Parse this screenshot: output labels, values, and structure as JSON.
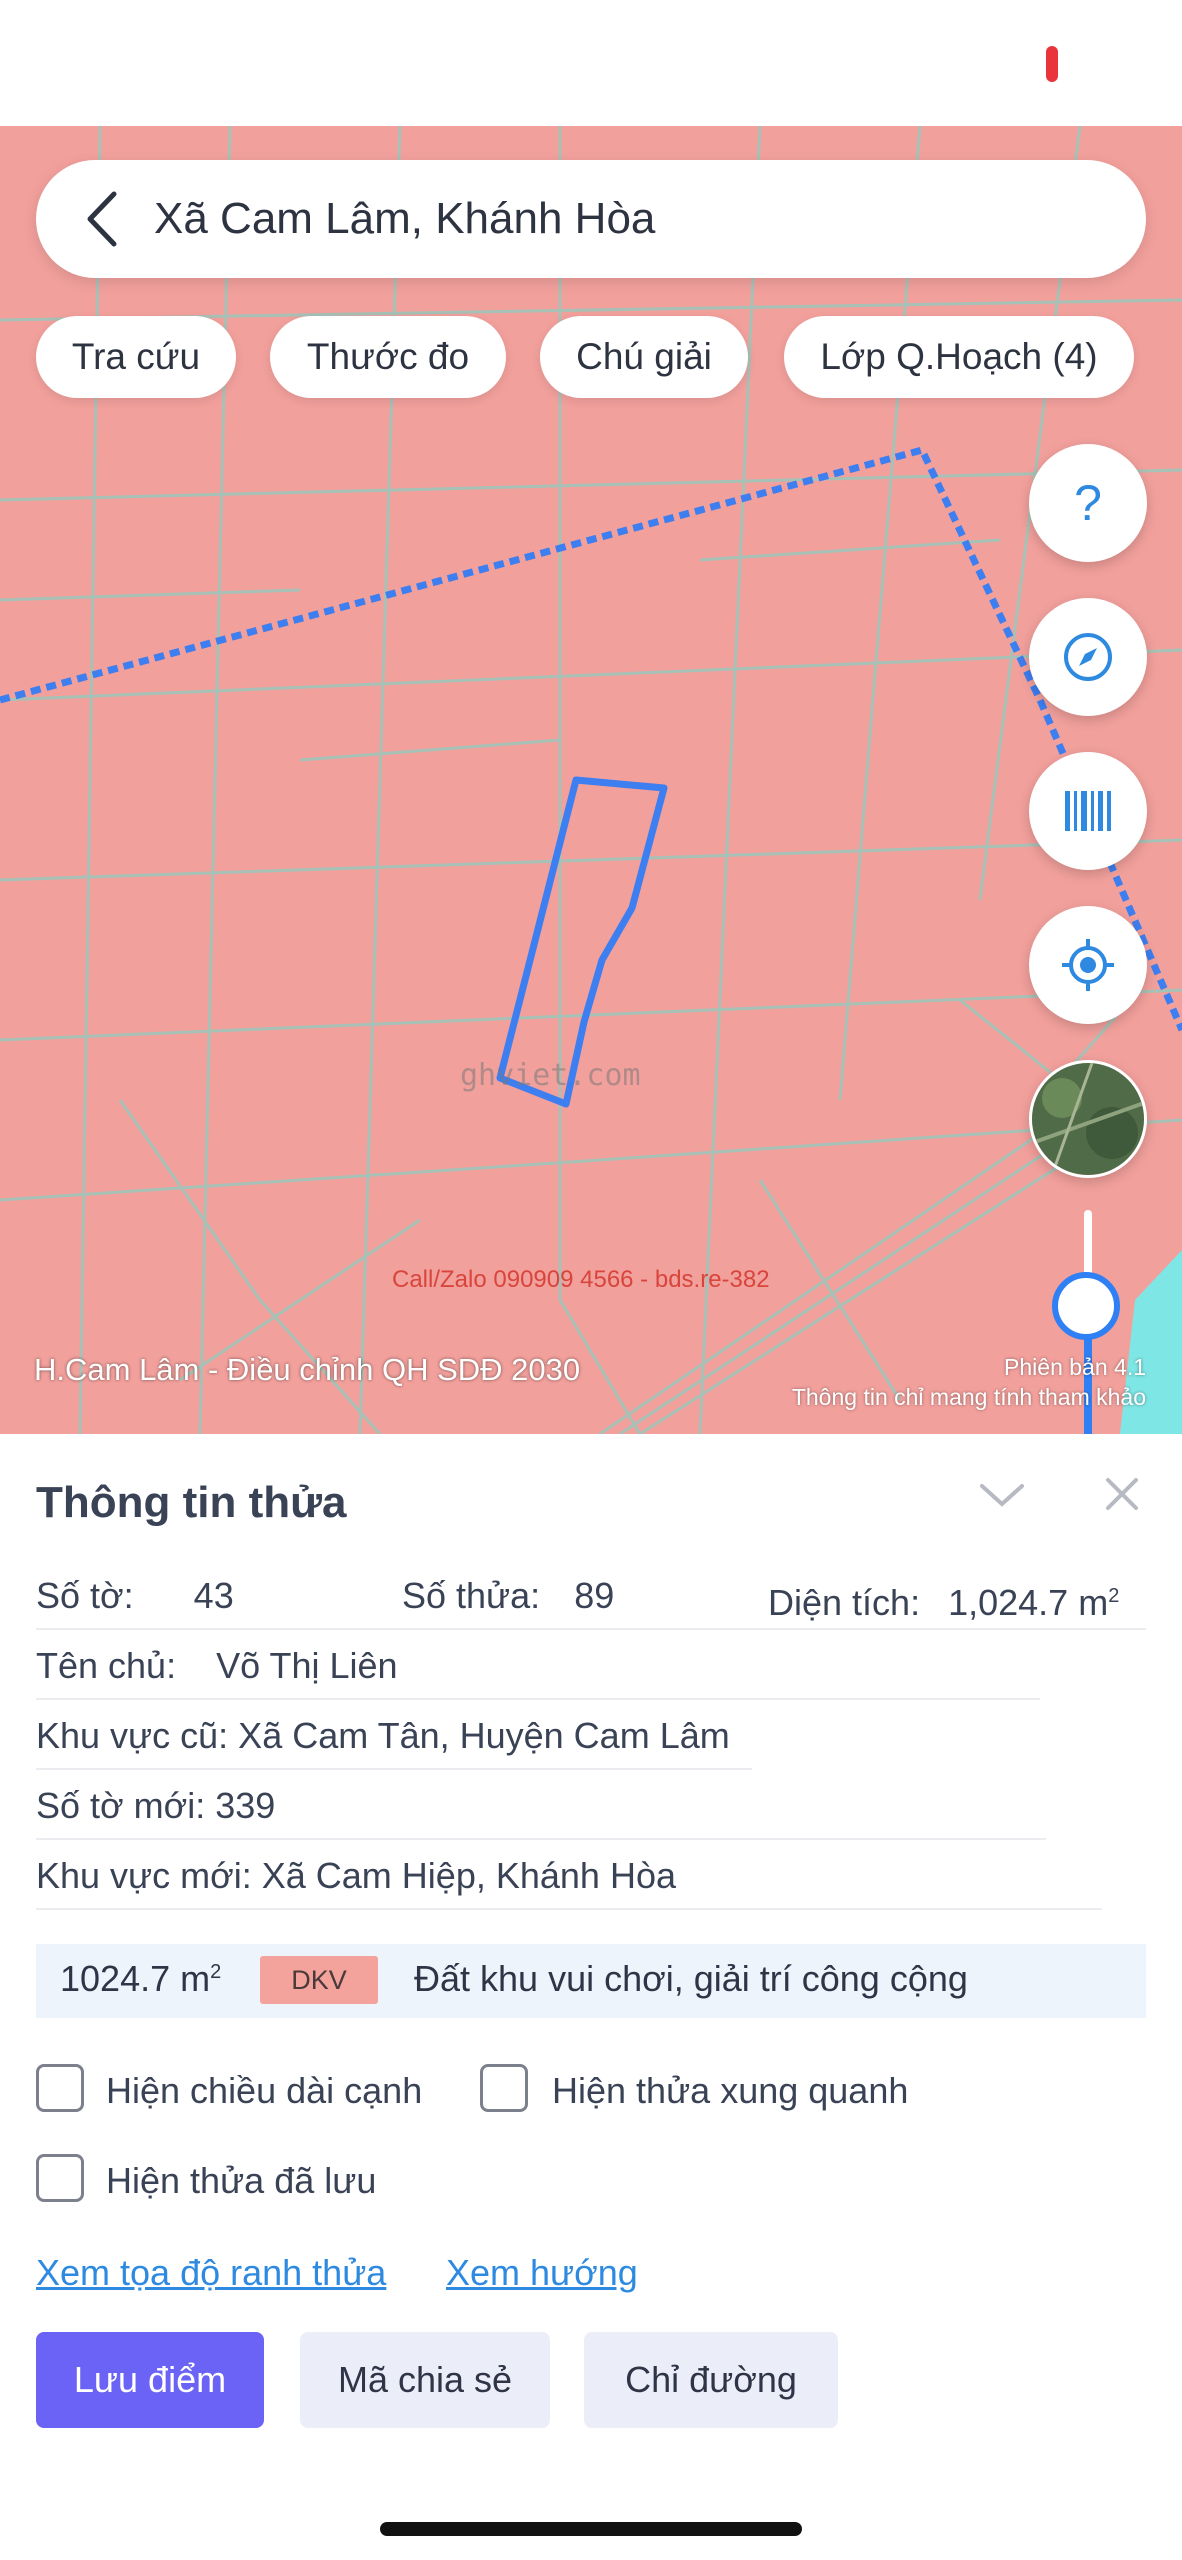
{
  "search": {
    "location": "Xã Cam Lâm, Khánh Hòa"
  },
  "chips": [
    "Tra cứu",
    "Thước đo",
    "Chú giải",
    "Lớp Q.Hoạch (4)"
  ],
  "map": {
    "caption": "H.Cam Lâm - Điều chỉnh QH SDĐ 2030",
    "note_version": "Phiên bản 4.1",
    "note": "Thông tin chỉ mang tính tham khảo",
    "ad": "Call/Zalo 090909 4566 - bds.re-382",
    "watermark": "ghviet.com",
    "colors": {
      "land": "#f2a09c",
      "parcel_outline": "#3d7ef0",
      "water": "#7fe6e6"
    }
  },
  "fabs": [
    "help-icon",
    "compass-icon",
    "barcode-icon",
    "locate-icon",
    "satellite-thumbnail"
  ],
  "panel": {
    "title": "Thông tin thửa",
    "so_to_label": "Số tờ:",
    "so_to_value": "43",
    "so_thua_label": "Số thửa:",
    "so_thua_value": "89",
    "dien_tich_label": "Diện tích:",
    "dien_tich_value": "1,024.7 m",
    "dien_tich_unit_sup": "2",
    "ten_chu_label": "Tên chủ:",
    "ten_chu_value": "Võ Thị Liên",
    "khu_vuc_cu": "Khu vực cũ: Xã Cam Tân, Huyện Cam Lâm",
    "so_to_moi": "Số tờ mới: 339",
    "khu_vuc_moi": "Khu vực mới: Xã Cam Hiệp, Khánh Hòa",
    "land_area": "1024.7 m",
    "land_area_sup": "2",
    "land_code": "DKV",
    "land_desc": "Đất khu vui chơi, giải trí công cộng",
    "cb_edge_length": "Hiện chiều dài cạnh",
    "cb_neighbors": "Hiện thửa xung quanh",
    "cb_saved": "Hiện thửa đã lưu",
    "link_coords": "Xem tọa độ ranh thửa",
    "link_direction": "Xem hướng",
    "btn_save": "Lưu điểm",
    "btn_share": "Mã chia sẻ",
    "btn_route": "Chỉ đường"
  }
}
